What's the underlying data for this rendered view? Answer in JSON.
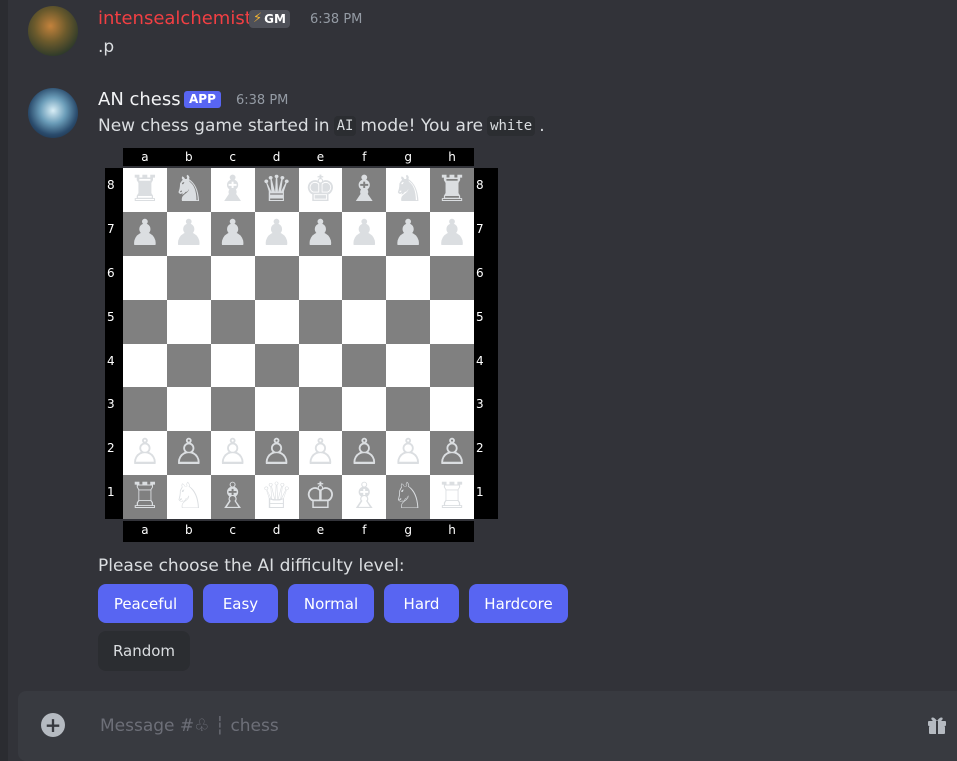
{
  "messages": [
    {
      "author": "intensealchemist",
      "badge": "GM",
      "badge_icon": "lightning-icon",
      "time": "6:38 PM",
      "text": ".p",
      "author_color": "#f23f43"
    },
    {
      "author": "AN chess",
      "badge": "APP",
      "time": "6:38 PM",
      "text_before": "New chess game started in",
      "code1": "AI",
      "text_mid": "mode! You are",
      "code2": "white",
      "text_after": "."
    }
  ],
  "board": {
    "files": [
      "a",
      "b",
      "c",
      "d",
      "e",
      "f",
      "g",
      "h"
    ],
    "ranks": [
      "8",
      "7",
      "6",
      "5",
      "4",
      "3",
      "2",
      "1"
    ],
    "rows": [
      [
        "♜",
        "♞",
        "♝",
        "♛",
        "♚",
        "♝",
        "♞",
        "♜"
      ],
      [
        "♟",
        "♟",
        "♟",
        "♟",
        "♟",
        "♟",
        "♟",
        "♟"
      ],
      [
        "",
        "",
        "",
        "",
        "",
        "",
        "",
        ""
      ],
      [
        "",
        "",
        "",
        "",
        "",
        "",
        "",
        ""
      ],
      [
        "",
        "",
        "",
        "",
        "",
        "",
        "",
        ""
      ],
      [
        "",
        "",
        "",
        "",
        "",
        "",
        "",
        ""
      ],
      [
        "♙",
        "♙",
        "♙",
        "♙",
        "♙",
        "♙",
        "♙",
        "♙"
      ],
      [
        "♖",
        "♘",
        "♗",
        "♕",
        "♔",
        "♗",
        "♘",
        "♖"
      ]
    ],
    "light_color": "#ffffff",
    "dark_color": "#808080"
  },
  "prompt": "Please choose the AI difficulty level:",
  "buttons": {
    "peaceful": "Peaceful",
    "easy": "Easy",
    "normal": "Normal",
    "hard": "Hard",
    "hardcore": "Hardcore",
    "random": "Random"
  },
  "composer": {
    "placeholder": "Message #♧ ┆ chess"
  },
  "colors": {
    "blurple": "#5865f2",
    "background": "#323339"
  }
}
